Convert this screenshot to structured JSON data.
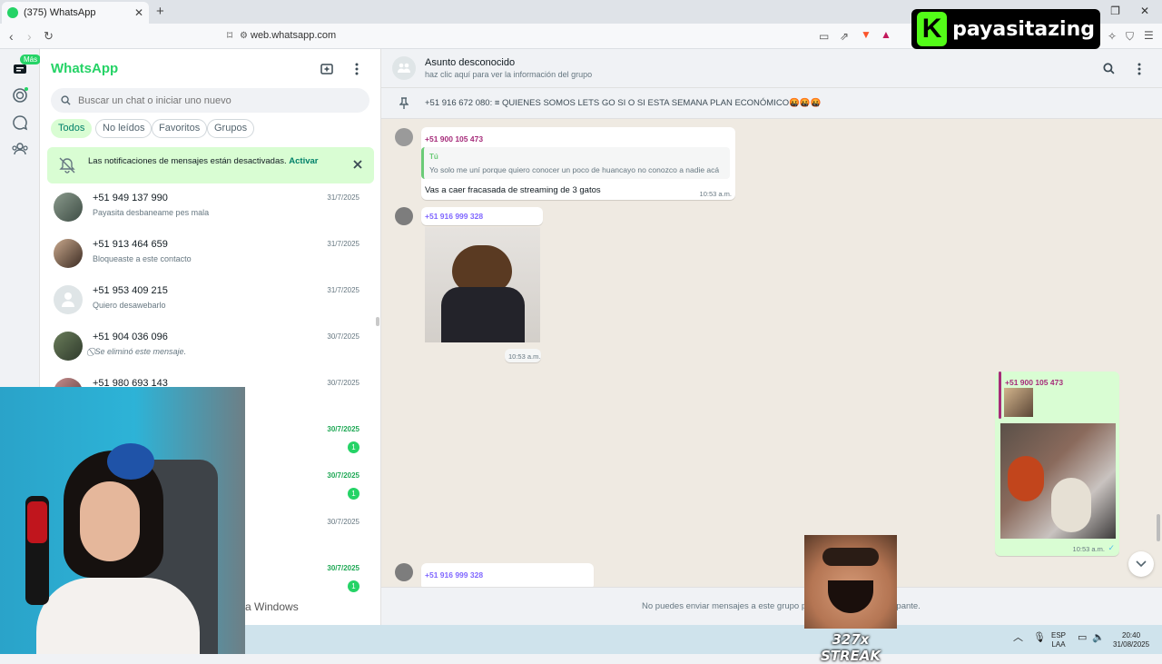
{
  "browser": {
    "tab_title": "(375) WhatsApp",
    "url": "web.whatsapp.com"
  },
  "brand_overlay": {
    "text": "payasitazing"
  },
  "rail": {
    "badge": "Más"
  },
  "sidebar": {
    "title": "WhatsApp",
    "search_placeholder": "Buscar un chat o iniciar uno nuevo",
    "filters": [
      "Todos",
      "No leídos",
      "Favoritos",
      "Grupos"
    ],
    "notice": {
      "text": "Las notificaciones de mensajes están desactivadas.",
      "link": "Activar"
    },
    "chats": [
      {
        "name": "+51 949 137 990",
        "preview": "Payasita desbaneame pes mala",
        "date": "31/7/2025"
      },
      {
        "name": "+51 913 464 659",
        "preview": "Bloqueaste a este contacto",
        "date": "31/7/2025"
      },
      {
        "name": "+51 953 409 215",
        "preview": "Quiero desawebarlo",
        "date": "31/7/2025"
      },
      {
        "name": "+51 904 036 096",
        "preview": "Se eliminó este mensaje.",
        "date": "30/7/2025"
      },
      {
        "name": "+51 980 693 143",
        "preview": "",
        "date": "30/7/2025"
      },
      {
        "name": "",
        "preview": "",
        "date": "30/7/2025",
        "unread": "1"
      },
      {
        "name": "",
        "preview": "",
        "date": "30/7/2025",
        "unread": "1"
      },
      {
        "name": "",
        "preview": "",
        "date": "30/7/2025"
      },
      {
        "name": "",
        "preview": "",
        "date": "30/7/2025",
        "unread": "1"
      }
    ],
    "windows_watermark": "a Windows"
  },
  "chat": {
    "title": "Asunto desconocido",
    "subtitle": "haz clic aquí para ver la información del grupo",
    "pinned": "+51 916 672 080: ≡ QUIENES SOMOS LETS GO SI O SI ESTA SEMANA PLAN ECONÓMICO🤬🤬🤬",
    "messages": [
      {
        "sender": "+51 900 105 473",
        "quote_author": "Tú",
        "quote_text": "Yo solo me uní porque quiero conocer un poco de huancayo no conozco a nadie acá",
        "text": "Vas a caer fracasada de streaming de 3 gatos",
        "time": "10:53 a.m."
      },
      {
        "sender": "+51 916 999 328",
        "time": "10:53 a.m."
      },
      {
        "sender": "+51 900 105 473",
        "time": "10:53 a.m."
      },
      {
        "sender": "+51 916 999 328"
      }
    ],
    "composer_text": "No puedes enviar mensajes a este grupo porque ya no eres participante."
  },
  "streak_overlay": {
    "label": "327x STREAK"
  },
  "taskbar": {
    "lang1": "ESP",
    "lang2": "LAA",
    "time": "20:40",
    "date": "31/08/2025"
  },
  "colors": {
    "accent": "#25d366",
    "outgoing": "#d9fdd3",
    "chat_bg": "#efeae2"
  }
}
